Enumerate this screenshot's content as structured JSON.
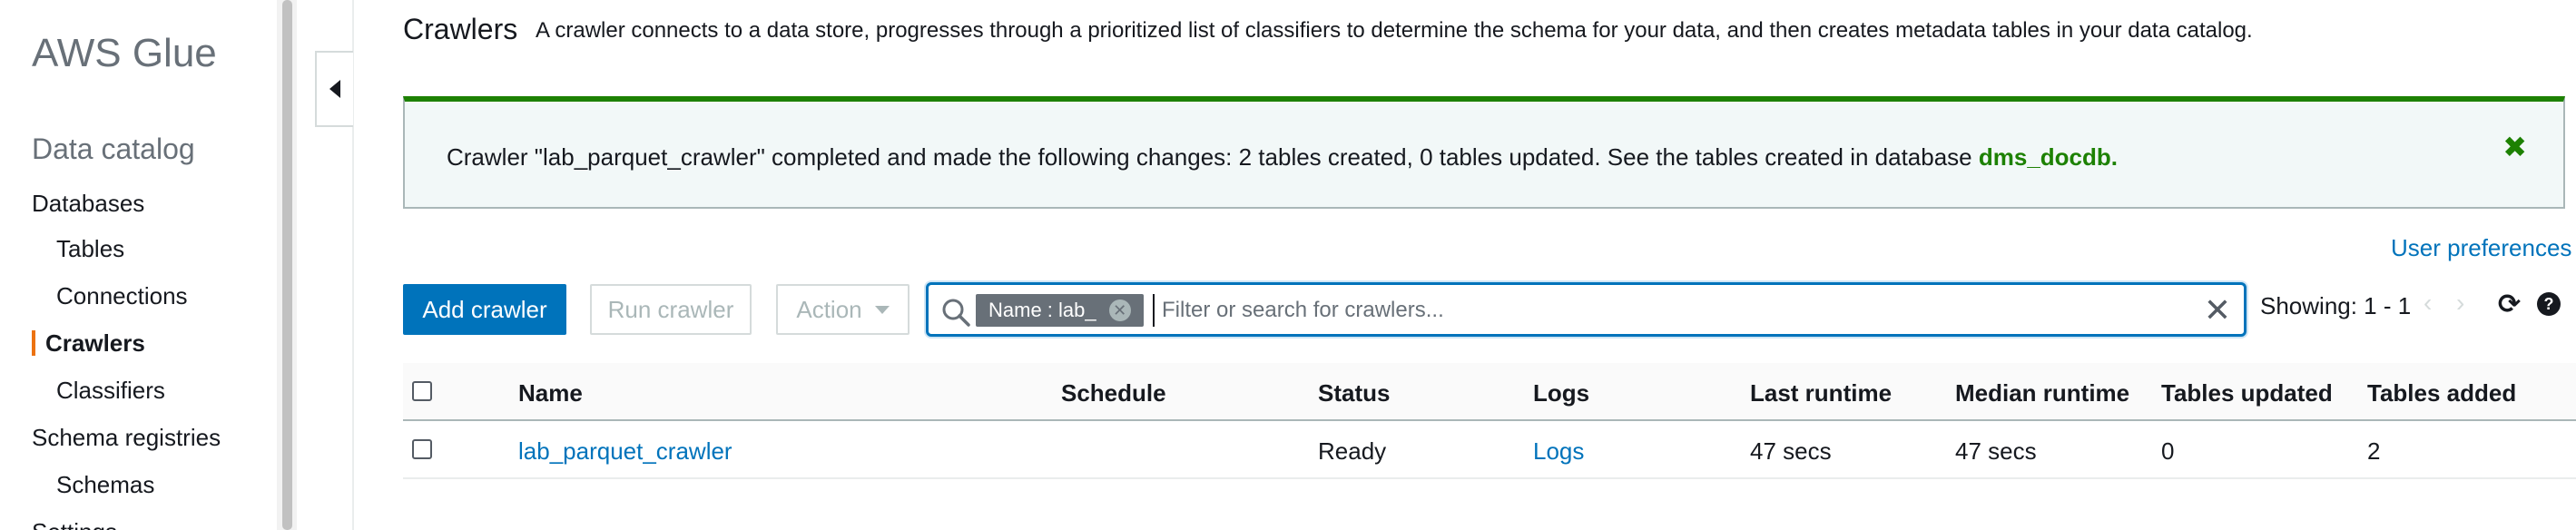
{
  "sidebar": {
    "brand": "AWS Glue",
    "section_title": "Data catalog",
    "items": [
      {
        "label": "Databases"
      },
      {
        "label": "Tables"
      },
      {
        "label": "Connections"
      },
      {
        "label": "Crawlers"
      },
      {
        "label": "Classifiers"
      },
      {
        "label": "Schema registries"
      },
      {
        "label": "Schemas"
      },
      {
        "label": "Settings"
      }
    ],
    "active_item": "Crawlers"
  },
  "header": {
    "title": "Crawlers",
    "description": "A crawler connects to a data store, progresses through a prioritized list of classifiers to determine the schema for your data, and then creates metadata tables in your data catalog."
  },
  "flash": {
    "message": "Crawler \"lab_parquet_crawler\" completed and made the following changes: 2 tables created, 0 tables updated. See the tables created in database ",
    "database_link": "dms_docdb.",
    "close_glyph": "✖"
  },
  "toolbar": {
    "user_preferences": "User preferences",
    "add_label": "Add crawler",
    "run_label": "Run crawler",
    "action_label": "Action",
    "filter_token": "Name : lab_",
    "search_placeholder": "Filter or search for crawlers...",
    "showing": "Showing: 1 - 1",
    "prev_glyph": "‹",
    "next_glyph": "›",
    "refresh_glyph": "⟳",
    "help_glyph": "?"
  },
  "table": {
    "columns": [
      "Name",
      "Schedule",
      "Status",
      "Logs",
      "Last runtime",
      "Median runtime",
      "Tables updated",
      "Tables added"
    ],
    "rows": [
      {
        "name": "lab_parquet_crawler",
        "schedule": "",
        "status": "Ready",
        "logs": "Logs",
        "last_runtime": "47 secs",
        "median_runtime": "47 secs",
        "tables_updated": "0",
        "tables_added": "2"
      }
    ]
  },
  "colors": {
    "primary": "#0073bb",
    "success": "#1d8102",
    "active_marker": "#ec7211"
  }
}
